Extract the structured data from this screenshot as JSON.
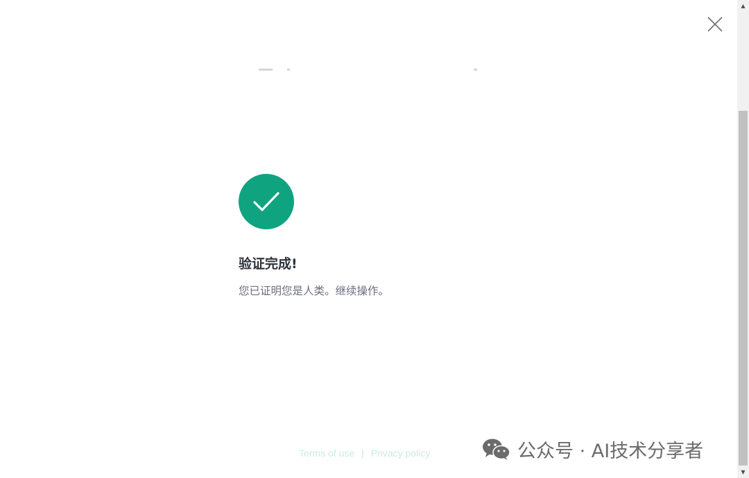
{
  "dialog": {
    "close_icon": "close-icon"
  },
  "verification": {
    "status_icon": "checkmark-icon",
    "accent_color": "#10a37f",
    "title": "验证完成!",
    "message": "您已证明您是人类。继续操作。"
  },
  "footer": {
    "terms_label": "Terms of use",
    "separator": "|",
    "privacy_label": "Privacy policy"
  },
  "watermark": {
    "icon": "wechat-icon",
    "text": "公众号 · AI技术分享者"
  },
  "scrollbar": {
    "up_icon": "scroll-up-arrow-icon",
    "down_icon": "scroll-down-arrow-icon"
  }
}
